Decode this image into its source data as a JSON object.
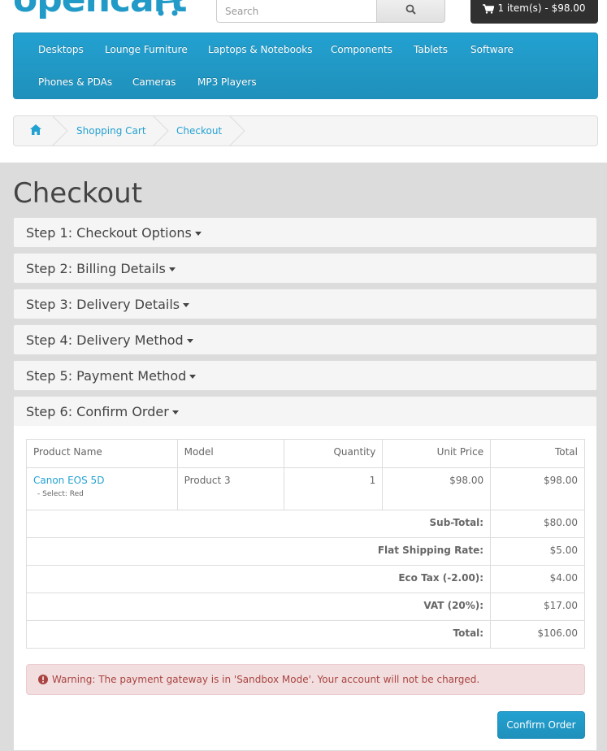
{
  "header": {
    "logo_text": "opencart",
    "search_placeholder": "Search",
    "cart_label": "1 item(s) - $98.00"
  },
  "menu": {
    "items": [
      "Desktops",
      "Lounge Furniture",
      "Laptops & Notebooks",
      "Components",
      "Tablets",
      "Software",
      "Phones & PDAs",
      "Cameras",
      "MP3 Players"
    ]
  },
  "breadcrumb": {
    "items": [
      "Shopping Cart",
      "Checkout"
    ]
  },
  "page": {
    "title": "Checkout",
    "steps": [
      "Step 1: Checkout Options",
      "Step 2: Billing Details",
      "Step 3: Delivery Details",
      "Step 4: Delivery Method",
      "Step 5: Payment Method",
      "Step 6: Confirm Order"
    ]
  },
  "order": {
    "columns": [
      "Product Name",
      "Model",
      "Quantity",
      "Unit Price",
      "Total"
    ],
    "product": {
      "name": "Canon EOS 5D",
      "option": "- Select: Red",
      "model": "Product 3",
      "quantity": "1",
      "unit_price": "$98.00",
      "total": "$98.00"
    },
    "totals": [
      {
        "label": "Sub-Total:",
        "value": "$80.00"
      },
      {
        "label": "Flat Shipping Rate:",
        "value": "$5.00"
      },
      {
        "label": "Eco Tax (-2.00):",
        "value": "$4.00"
      },
      {
        "label": "VAT (20%):",
        "value": "$17.00"
      },
      {
        "label": "Total:",
        "value": "$106.00"
      }
    ]
  },
  "alert": {
    "text": "Warning: The payment gateway is in 'Sandbox Mode'. Your account will not be charged."
  },
  "confirm_button": "Confirm Order",
  "colors": {
    "accent": "#229ac8",
    "cart_button": "#303030",
    "alert_bg": "#f2dede",
    "alert_text": "#a94442"
  }
}
